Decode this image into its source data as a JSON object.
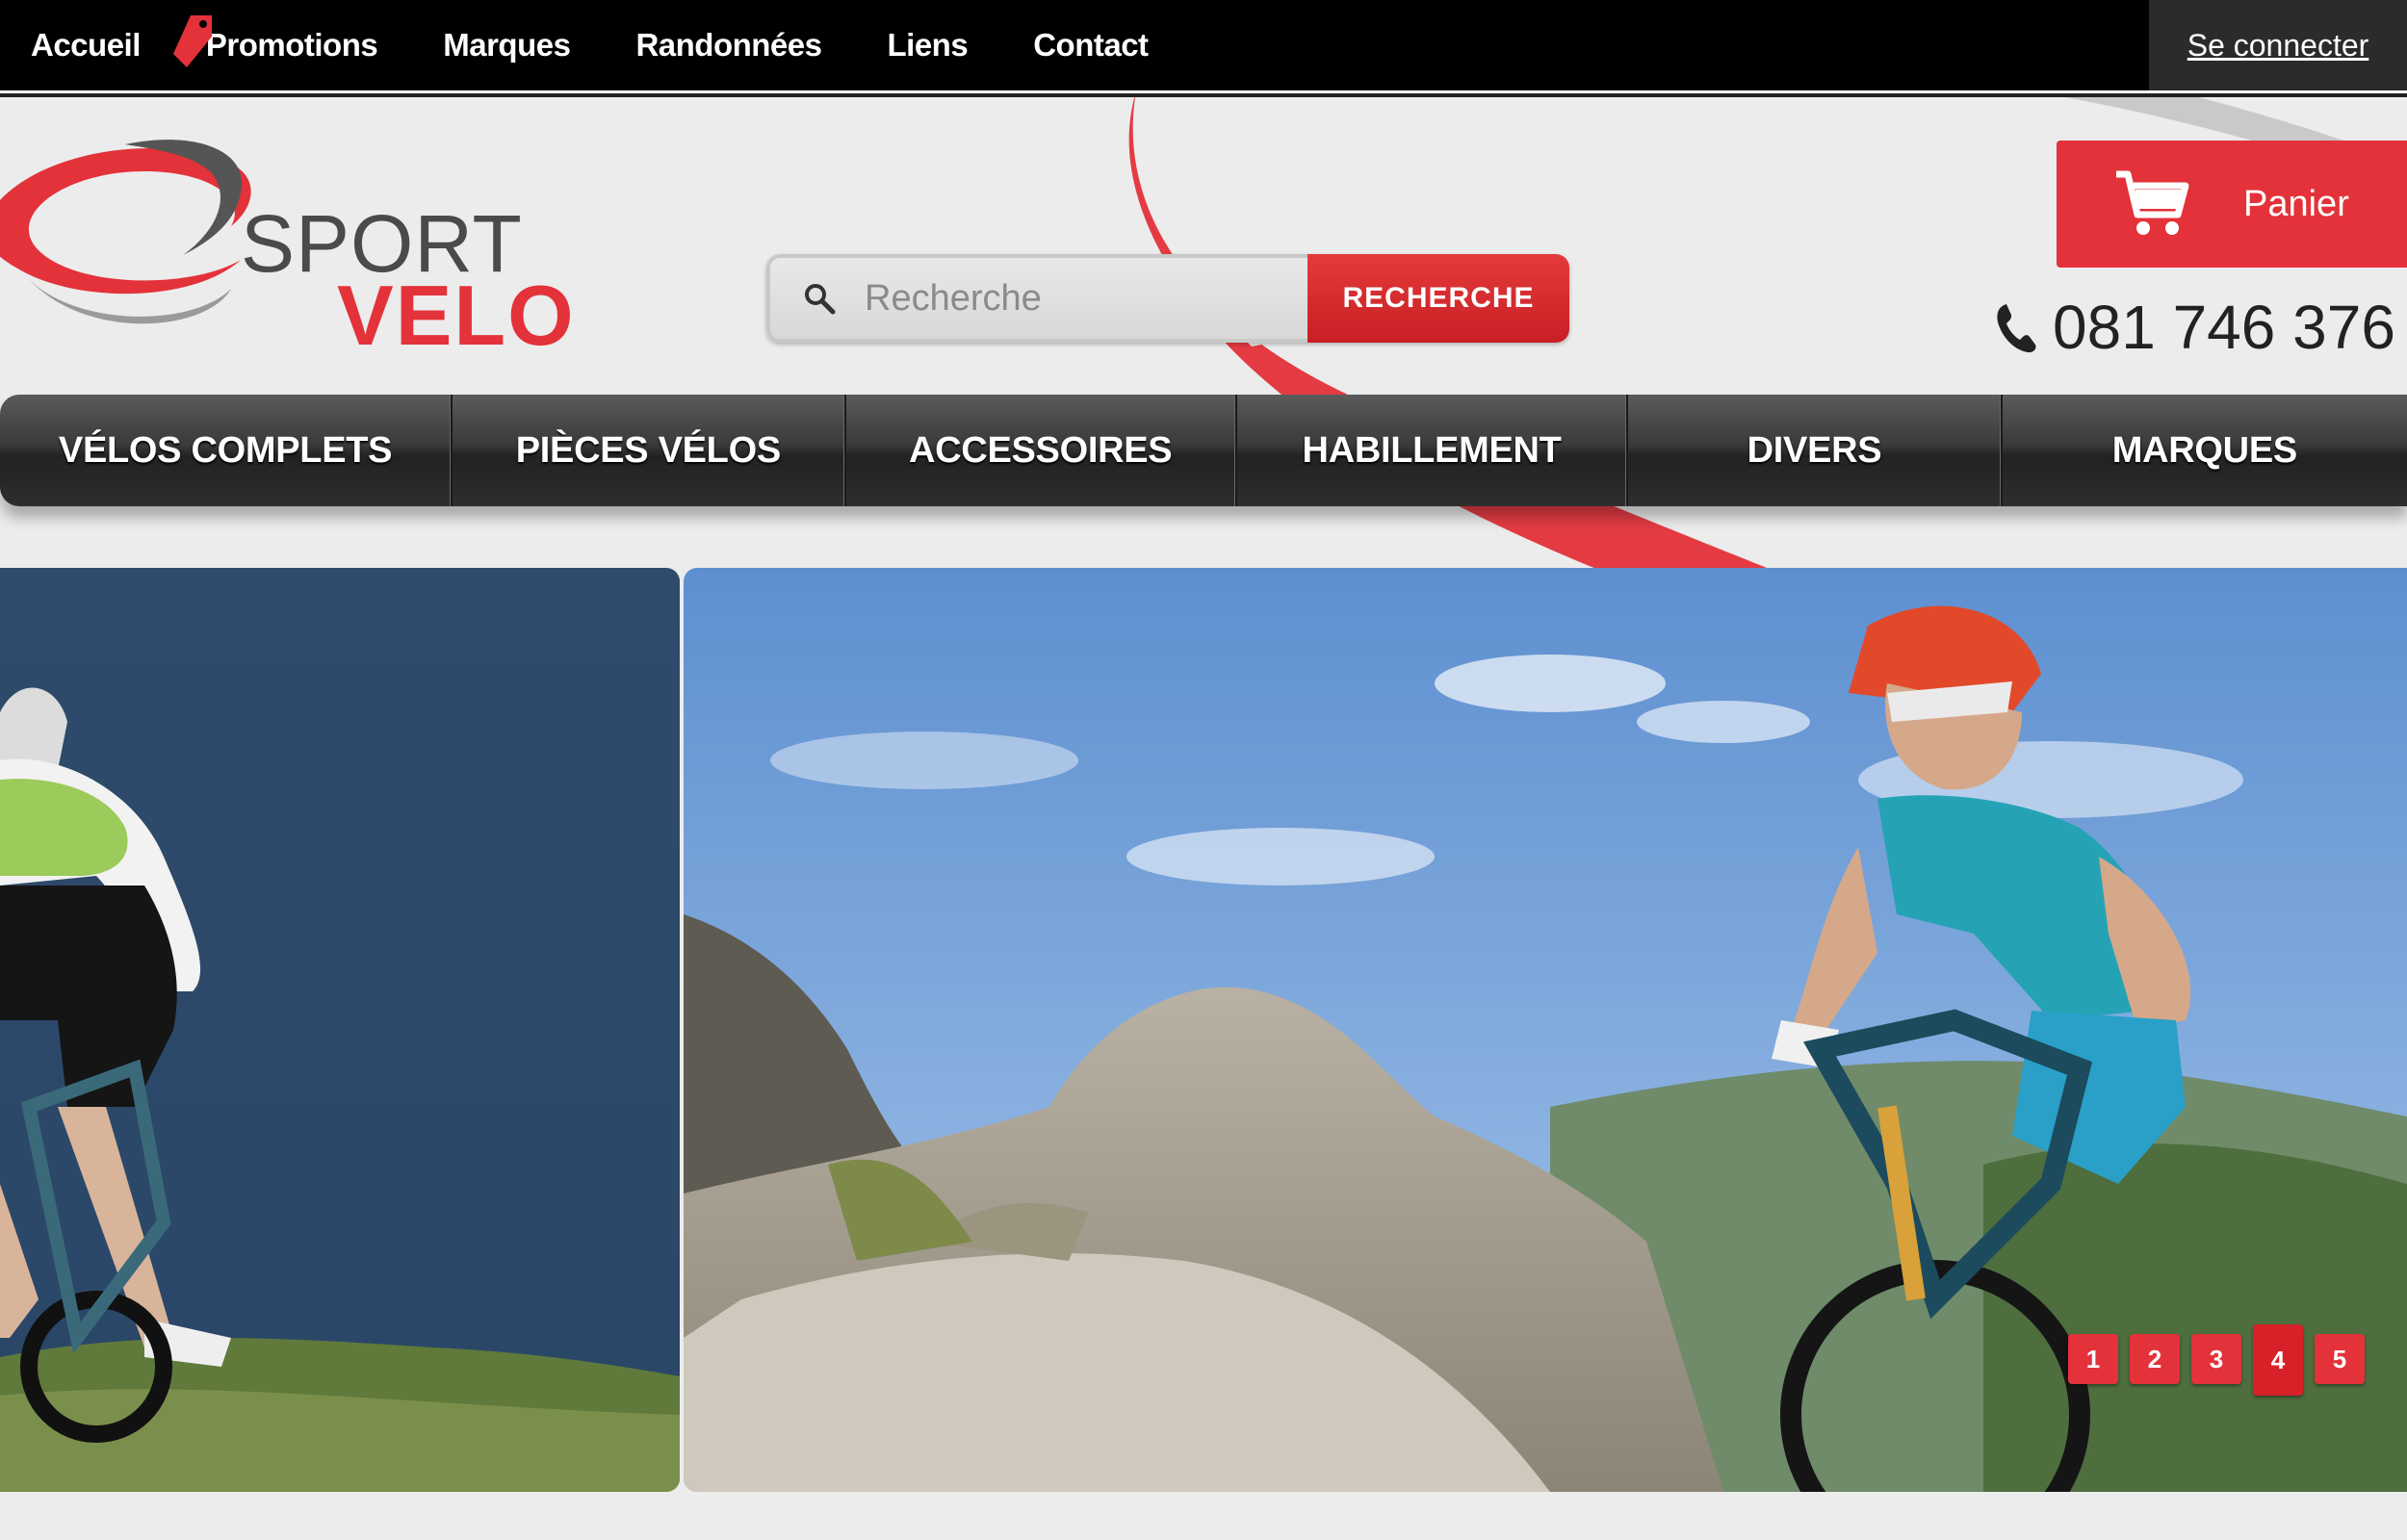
{
  "topnav": {
    "items": [
      {
        "label": "Accueil"
      },
      {
        "label": "Promotions"
      },
      {
        "label": "Marques"
      },
      {
        "label": "Randonnées"
      },
      {
        "label": "Liens"
      },
      {
        "label": "Contact"
      }
    ],
    "login_label": "Se connecter"
  },
  "logo": {
    "line1": "SPORT",
    "line2": "VELO"
  },
  "search": {
    "placeholder": "Recherche",
    "button_label": "RECHERCHE"
  },
  "cart": {
    "label": "Panier",
    "icon": "cart-icon"
  },
  "phone": {
    "number": "081 746 376",
    "icon": "phone-icon"
  },
  "categories": [
    {
      "label": "VÉLOS COMPLETS"
    },
    {
      "label": "PIÈCES VÉLOS"
    },
    {
      "label": "ACCESSOIRES"
    },
    {
      "label": "HABILLEMENT"
    },
    {
      "label": "DIVERS"
    },
    {
      "label": "MARQUES"
    }
  ],
  "slider": {
    "pages": [
      "1",
      "2",
      "3",
      "4",
      "5"
    ],
    "active_page": "4"
  },
  "colors": {
    "accent": "#e4323a",
    "topbar": "#000000",
    "nav": "#333333"
  }
}
